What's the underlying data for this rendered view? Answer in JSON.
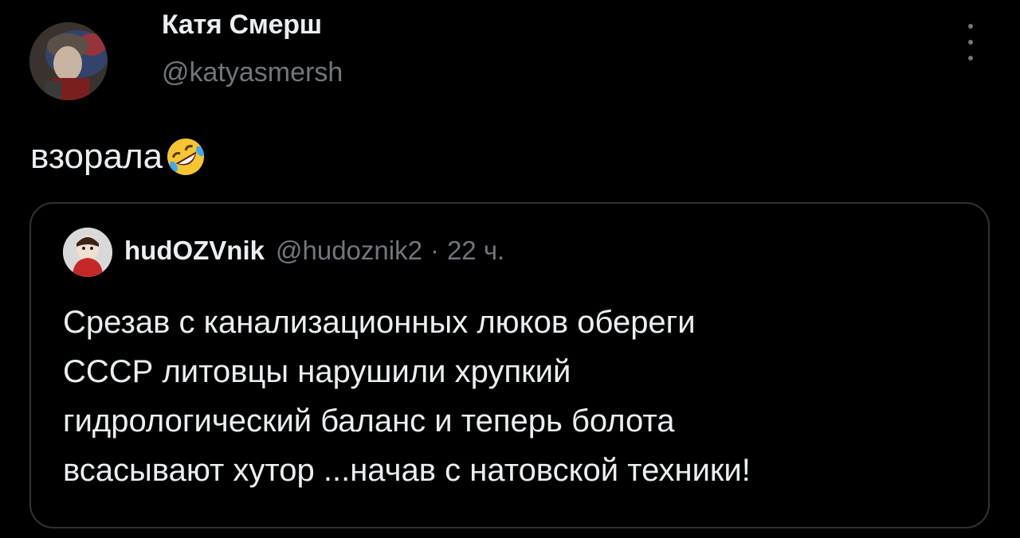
{
  "tweet": {
    "author_name": "Катя Смерш",
    "author_handle": "@katyasmersh",
    "text": "взорала",
    "emoji": "rolling-on-floor-laughing-icon"
  },
  "quote": {
    "author_name": "hudOZVnik",
    "author_handle": "@hudoznik2",
    "separator": "·",
    "time": "22 ч.",
    "lines": [
      "Срезав с канализационных люков обереги",
      "СССР литовцы нарушили хрупкий",
      "гидрологический баланс и теперь болота",
      "всасывают хутор ...начав с натовской техники!"
    ]
  },
  "colors": {
    "background": "#000000",
    "text_primary": "#eceff1",
    "text_secondary": "#71767b",
    "border": "#2f3336"
  }
}
